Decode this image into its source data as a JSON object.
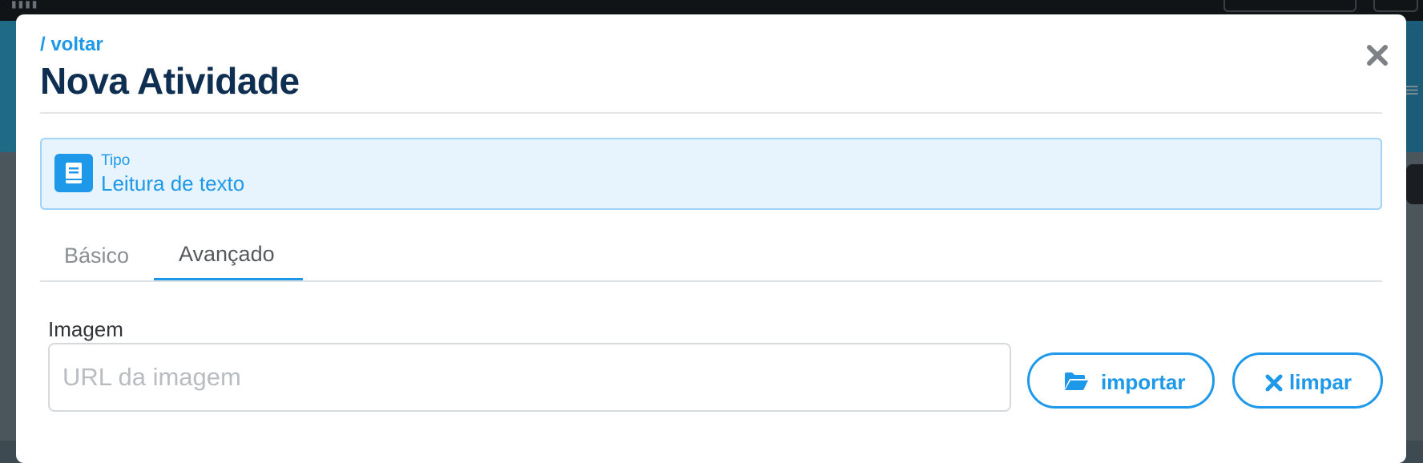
{
  "modal": {
    "back_link": "/ voltar",
    "title": "Nova Atividade"
  },
  "type": {
    "label": "Tipo",
    "value": "Leitura de texto",
    "icon": "book-icon"
  },
  "tabs": [
    {
      "label": "Básico",
      "active": false
    },
    {
      "label": "Avançado",
      "active": true
    }
  ],
  "image_field": {
    "label": "Imagem",
    "value": "",
    "placeholder": "URL da imagem"
  },
  "buttons": {
    "import_label": "importar",
    "import_icon": "folder-open-icon",
    "clear_label": "limpar",
    "clear_icon": "times-icon"
  },
  "colors": {
    "accent": "#1e98e8",
    "title": "#0f2f52",
    "type_box_bg": "#e8f4fd",
    "type_box_border": "#9fd3f7"
  }
}
